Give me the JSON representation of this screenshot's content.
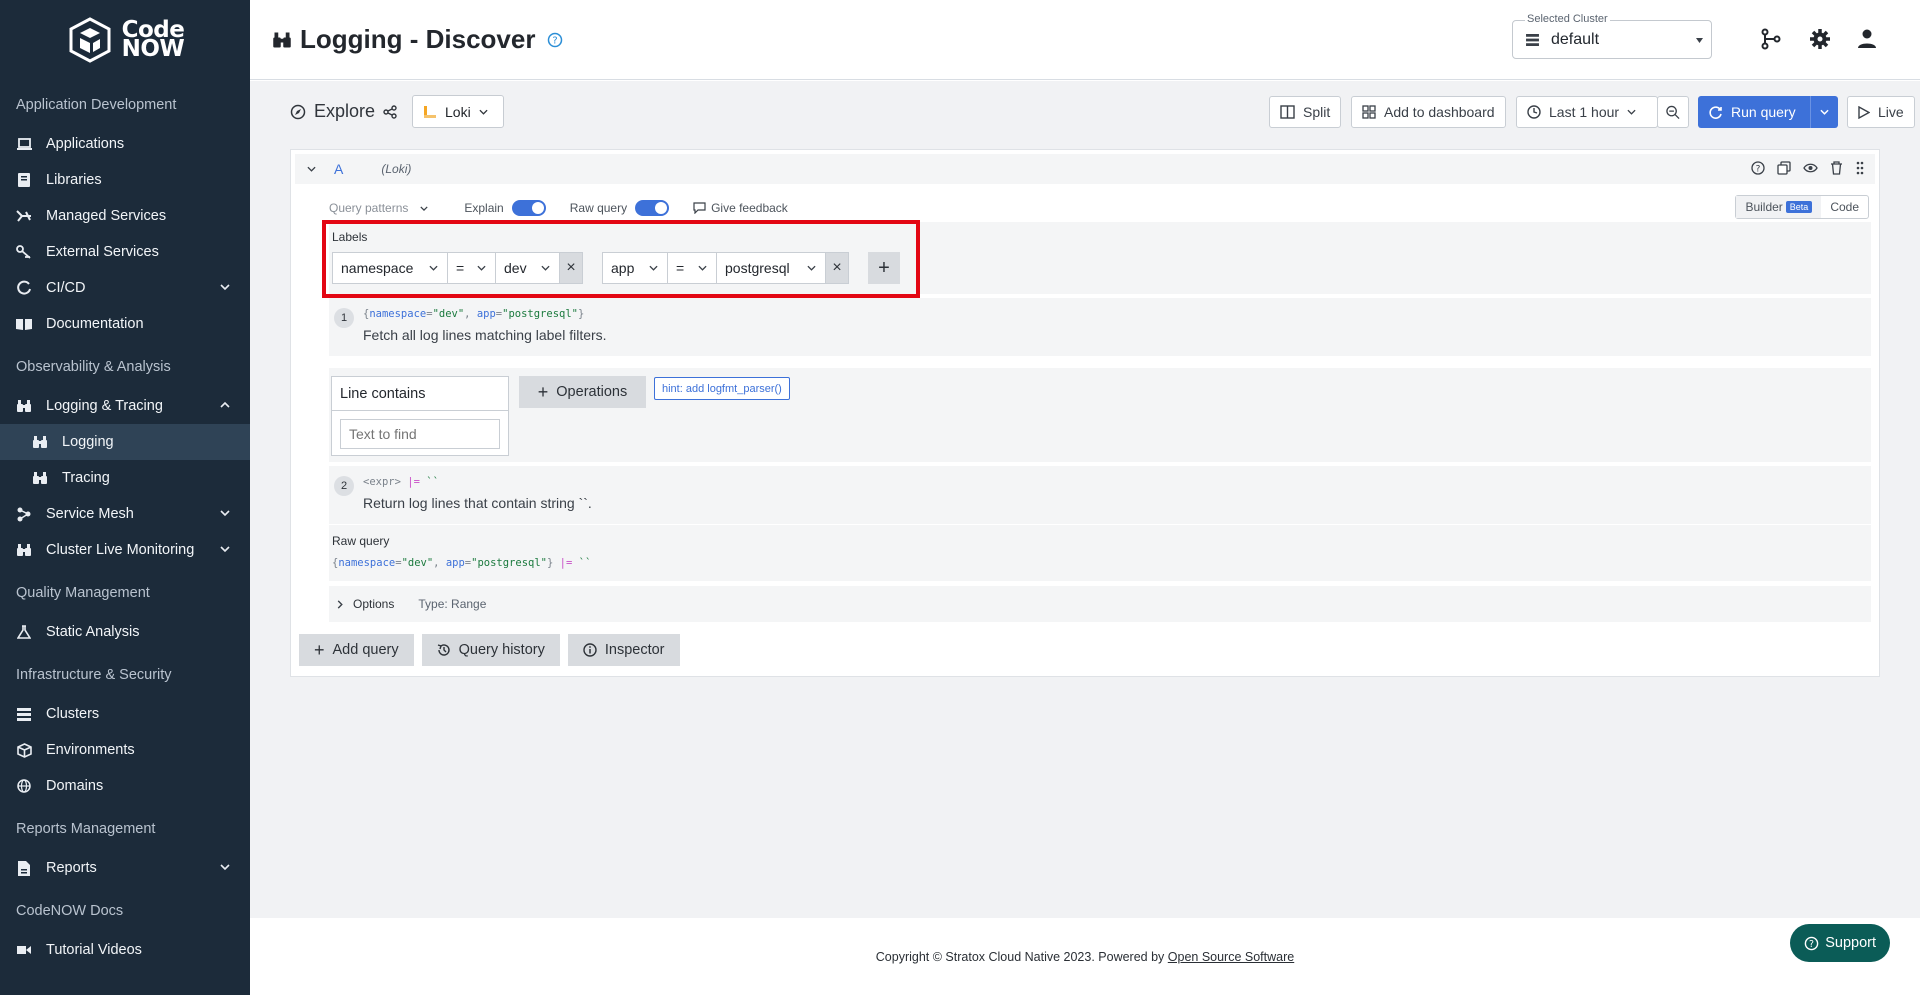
{
  "sidebar": {
    "logo_line1": "Code",
    "logo_line2": "NOW",
    "sections": {
      "app_dev": "Application Development",
      "observability": "Observability & Analysis",
      "quality": "Quality Management",
      "infra": "Infrastructure & Security",
      "reports": "Reports Management",
      "docs": "CodeNOW Docs"
    },
    "items": {
      "applications": "Applications",
      "libraries": "Libraries",
      "managed_services": "Managed Services",
      "external_services": "External Services",
      "cicd": "CI/CD",
      "documentation": "Documentation",
      "logging_tracing": "Logging & Tracing",
      "logging": "Logging",
      "tracing": "Tracing",
      "service_mesh": "Service Mesh",
      "cluster_live": "Cluster Live Monitoring",
      "static_analysis": "Static Analysis",
      "clusters": "Clusters",
      "environments": "Environments",
      "domains": "Domains",
      "reports": "Reports",
      "tutorial_videos": "Tutorial Videos"
    }
  },
  "header": {
    "title": "Logging - Discover",
    "cluster_label": "Selected Cluster",
    "cluster_value": "default"
  },
  "explore": {
    "title": "Explore",
    "datasource": "Loki",
    "split": "Split",
    "add_to_dashboard": "Add to dashboard",
    "time_range": "Last 1 hour",
    "run_query": "Run query",
    "live": "Live"
  },
  "query": {
    "ref": "A",
    "datasource_tag": "(Loki)",
    "query_patterns": "Query patterns",
    "explain": "Explain",
    "raw_query_toggle": "Raw query",
    "give_feedback": "Give feedback",
    "builder": "Builder",
    "beta": "Beta",
    "code": "Code",
    "labels_title": "Labels",
    "label1_key": "namespace",
    "label1_op": "=",
    "label1_value": "dev",
    "label2_key": "app",
    "label2_op": "=",
    "label2_value": "postgresql",
    "step1_num": "1",
    "step1_code_open": "{",
    "step1_k1": "namespace",
    "step1_eq1": "=",
    "step1_v1": "\"dev\"",
    "step1_sep": ", ",
    "step1_k2": "app",
    "step1_eq2": "=",
    "step1_v2": "\"postgresql\"",
    "step1_code_close": "}",
    "step1_text": "Fetch all log lines matching label filters.",
    "op_card_title": "Line contains",
    "op_input_placeholder": "Text to find",
    "operations": "Operations",
    "hint": "hint: add logfmt_parser()",
    "step2_num": "2",
    "step2_expr": "<expr>",
    "step2_op": "|=",
    "step2_val": "``",
    "step2_text": "Return log lines that contain string ``.",
    "raw_title": "Raw query",
    "raw_open": "{",
    "raw_k1": "namespace",
    "raw_eq1": "=",
    "raw_v1": "\"dev\"",
    "raw_sep": ", ",
    "raw_k2": "app",
    "raw_eq2": "=",
    "raw_v2": "\"postgresql\"",
    "raw_close": "}",
    "raw_op": "|=",
    "raw_val": "``",
    "options": "Options",
    "options_type": "Type: Range"
  },
  "bottom": {
    "add_query": "Add query",
    "query_history": "Query history",
    "inspector": "Inspector"
  },
  "footer": {
    "copyright": "Copyright © Stratox Cloud Native 2023. Powered by ",
    "link": "Open Source Software",
    "support": "Support"
  },
  "colors": {
    "sidebar_bg": "#1c2b3a",
    "accent": "#3d71d9",
    "highlight": "#e30613",
    "support": "#0b5c57"
  }
}
